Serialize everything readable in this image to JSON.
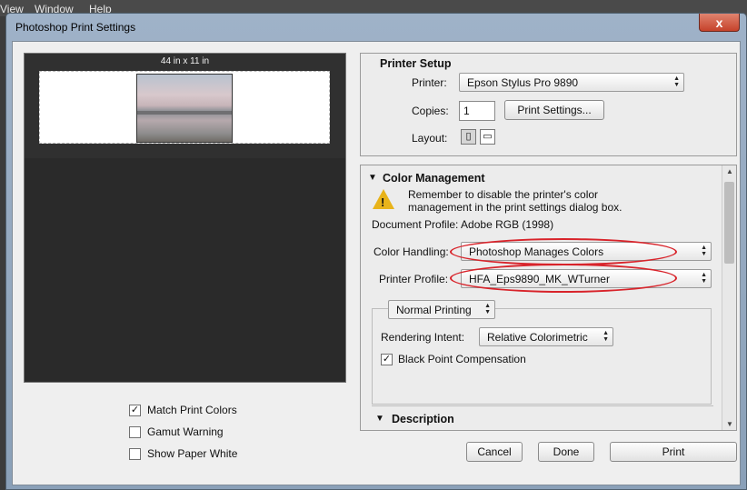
{
  "background": {
    "menu_view": "View",
    "menu_window": "Window",
    "menu_help": "Help"
  },
  "dialog": {
    "title": "Photoshop Print Settings",
    "close_glyph": "x"
  },
  "preview": {
    "size_label": "44 in x 11 in"
  },
  "options": {
    "match_print_colors": {
      "label": "Match Print Colors",
      "checked": true
    },
    "gamut_warning": {
      "label": "Gamut Warning",
      "checked": false
    },
    "show_paper_white": {
      "label": "Show Paper White",
      "checked": false
    }
  },
  "printer_setup": {
    "title": "Printer Setup",
    "printer_label": "Printer:",
    "printer_value": "Epson Stylus Pro 9890",
    "copies_label": "Copies:",
    "copies_value": "1",
    "print_settings_button": "Print Settings...",
    "layout_label": "Layout:"
  },
  "color_management": {
    "title": "Color Management",
    "warning_text": "Remember to disable the printer's color management in the print settings dialog box.",
    "document_profile": "Document Profile: Adobe RGB (1998)",
    "color_handling_label": "Color Handling:",
    "color_handling_value": "Photoshop Manages Colors",
    "printer_profile_label": "Printer Profile:",
    "printer_profile_value": "HFA_Eps9890_MK_WTurner",
    "printing_mode_value": "Normal Printing",
    "rendering_intent_label": "Rendering Intent:",
    "rendering_intent_value": "Relative Colorimetric",
    "black_point_label": "Black Point Compensation",
    "black_point_checked": true,
    "description_title": "Description"
  },
  "buttons": {
    "cancel": "Cancel",
    "done": "Done",
    "print": "Print"
  },
  "colors": {
    "highlight_ellipse": "#d8232a",
    "warning_icon": "#e8b31a",
    "preview_bg": "#2a2a2a"
  }
}
